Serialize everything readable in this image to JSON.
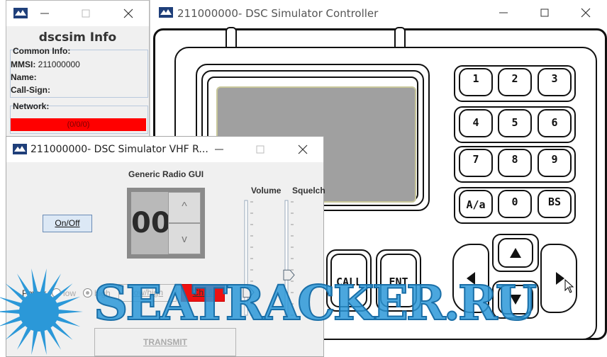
{
  "info_window": {
    "title": "dscsim Info",
    "common_info_label": "Common Info:",
    "mmsi_label": "MMSI:",
    "mmsi_value": "211000000",
    "name_label": "Name:",
    "callsign_label": "Call-Sign:",
    "network_label": "Network:",
    "network_status": "(0/0/0)",
    "network_status_color": "#ff0000"
  },
  "controller_window": {
    "title": "211000000- DSC Simulator Controller",
    "keypad": [
      "1",
      "2",
      "3",
      "4",
      "5",
      "6",
      "7",
      "8",
      "9",
      "A/a",
      "0",
      "BS"
    ],
    "call_label": "CALL",
    "ent_label": "ENT",
    "arrows": [
      "up-arrow-icon",
      "down-arrow-icon",
      "left-arrow-icon",
      "right-arrow-icon"
    ],
    "screen_color": "#a0a0a0"
  },
  "vhf_window": {
    "title": "211000000- DSC Simulator VHF R...",
    "heading": "Generic Radio GUI",
    "onoff_label": "On/Off",
    "channel_display": "00",
    "up_label": "^",
    "down_label": "v",
    "volume_label": "Volume",
    "squelch_label": "Squelch",
    "power_label": "Power",
    "power_low_label": "low",
    "power_high_label": "high",
    "power_selected": "high",
    "lowhigh_label": "low/high",
    "ch16_label": "Ch16",
    "transmit_label": "TRANSMIT",
    "volume_level": 0.2,
    "squelch_level": 0.35
  },
  "watermark": {
    "text": "SEATRACKER.RU",
    "color": "#2b98d8"
  }
}
